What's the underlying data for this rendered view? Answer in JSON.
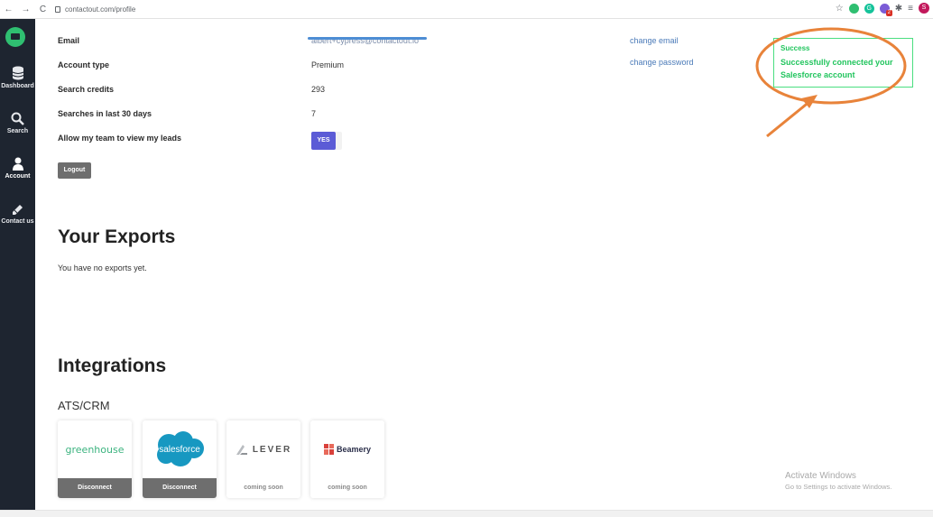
{
  "browser": {
    "url": "contactout.com/profile",
    "nav": {
      "back": "←",
      "forward": "→",
      "reload": "C"
    },
    "profile_initial": "S",
    "badge_count": "2"
  },
  "sidebar": {
    "items": [
      {
        "label": "Dashboard",
        "icon": "database-icon"
      },
      {
        "label": "Search",
        "icon": "search-icon"
      },
      {
        "label": "Account",
        "icon": "user-icon"
      },
      {
        "label": "Contact us",
        "icon": "pencil-icon"
      }
    ]
  },
  "account": {
    "email_label": "Email",
    "email_value": "albert+cypress@contactout.io",
    "account_type_label": "Account type",
    "account_type_value": "Premium",
    "search_credits_label": "Search credits",
    "search_credits_value": "293",
    "searches_label": "Searches in last 30 days",
    "searches_value": "7",
    "team_label": "Allow my team to view my leads",
    "team_toggle": "YES",
    "change_email": "change email",
    "change_password": "change password",
    "logout": "Logout"
  },
  "exports": {
    "title": "Your Exports",
    "empty": "You have no exports yet."
  },
  "integrations": {
    "title": "Integrations",
    "subtitle": "ATS/CRM",
    "cards": [
      {
        "name": "greenhouse",
        "action": "Disconnect"
      },
      {
        "name": "salesforce",
        "action": "Disconnect"
      },
      {
        "name": "LEVER",
        "action": "coming soon"
      },
      {
        "name": "Beamery",
        "action": "coming soon"
      }
    ]
  },
  "toast": {
    "title": "Success",
    "message": "Successfully connected your Salesforce account"
  },
  "watermark": {
    "line1": "Activate Windows",
    "line2": "Go to Settings to activate Windows."
  },
  "colors": {
    "sidebar": "#1e2530",
    "brand_green": "#2fbf71",
    "toggle": "#5b5bd6",
    "success": "#22c55e",
    "annotation": "#e8833a"
  }
}
